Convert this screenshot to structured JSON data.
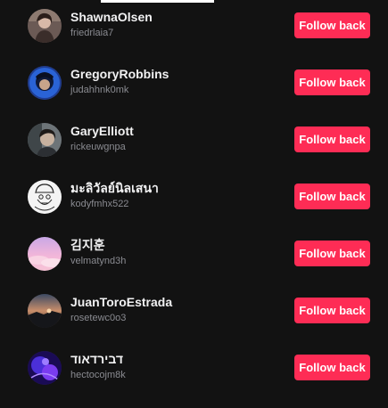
{
  "follow_label": "Follow back",
  "accent_color": "#fe2c55",
  "users": [
    {
      "name": "ShawnaOlsen",
      "handle": "friedrlaia7",
      "avatar_icon": "person-photo-icon"
    },
    {
      "name": "GregoryRobbins",
      "handle": "judahhnk0mk",
      "avatar_icon": "person-photo-icon"
    },
    {
      "name": "GaryElliott",
      "handle": "rickeuwgnpa",
      "avatar_icon": "person-photo-icon"
    },
    {
      "name": "มะลิวัลย์นิลเสนา",
      "handle": "kodyfmhx522",
      "avatar_icon": "cartoon-face-icon"
    },
    {
      "name": "김지훈",
      "handle": "velmatynd3h",
      "avatar_icon": "pink-sky-icon"
    },
    {
      "name": "JuanToroEstrada",
      "handle": "rosetewc0o3",
      "avatar_icon": "sunset-landscape-icon"
    },
    {
      "name": "דבירדאוד",
      "handle": "hectocojm8k",
      "avatar_icon": "purple-abstract-icon"
    }
  ]
}
